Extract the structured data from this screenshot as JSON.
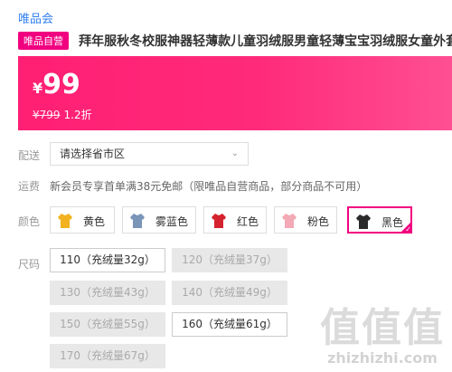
{
  "header": {
    "brand": "唯品会",
    "badge": "唯品自营",
    "product_title": "拜年服秋冬校服神器轻薄款儿童羽绒服男童轻薄宝宝羽绒服女童外套"
  },
  "price": {
    "currency": "¥",
    "current": "99",
    "original": "¥799",
    "discount": "1.2折"
  },
  "delivery": {
    "label": "配送",
    "select_value": "请选择省市区"
  },
  "shipping": {
    "label": "运费",
    "text": "新会员专享首单满38元免邮（限唯品自营商品，部分商品不可用）"
  },
  "colors": {
    "label": "颜色",
    "options": [
      {
        "name": "黄色",
        "swatch": "#f2b21f",
        "selected": false
      },
      {
        "name": "雾蓝色",
        "swatch": "#7a95b8",
        "selected": false
      },
      {
        "name": "红色",
        "swatch": "#d4232e",
        "selected": false
      },
      {
        "name": "粉色",
        "swatch": "#f3a9b6",
        "selected": false
      },
      {
        "name": "黑色",
        "swatch": "#2a2a2a",
        "selected": true
      }
    ],
    "accent": "#f10180"
  },
  "sizes": {
    "label": "尺码",
    "options": [
      {
        "text": "110（充绒量32g）",
        "available": true
      },
      {
        "text": "120（充绒量37g）",
        "available": false
      },
      {
        "text": "130（充绒量43g）",
        "available": false
      },
      {
        "text": "140（充绒量49g）",
        "available": false
      },
      {
        "text": "150（充绒量55g）",
        "available": false
      },
      {
        "text": "160（充绒量61g）",
        "available": true
      },
      {
        "text": "170（充绒量67g）",
        "available": false
      }
    ]
  },
  "watermark": {
    "logo": "值值值",
    "domain": "zhizhizhi.com"
  }
}
